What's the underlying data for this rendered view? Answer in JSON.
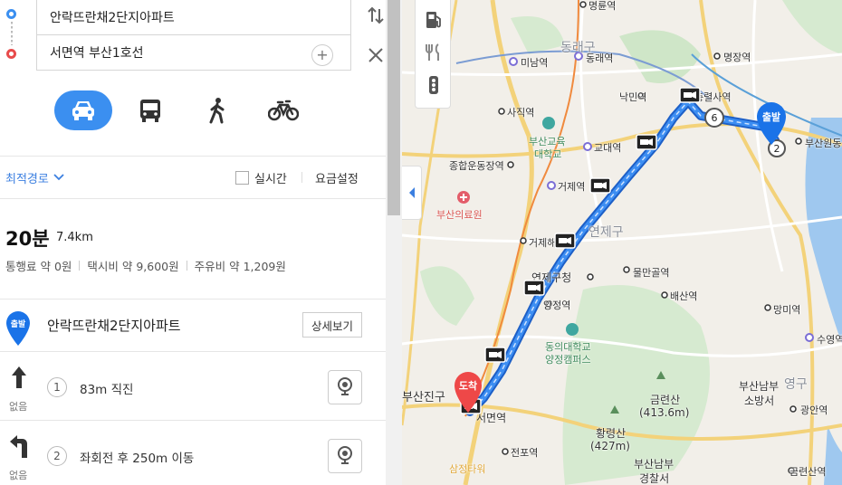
{
  "route": {
    "origin": "안락뜨란채2단지아파트",
    "destination": "서면역 부산1호선",
    "add_waypoint": "+"
  },
  "modes": [
    "car-icon",
    "bus-icon",
    "walk-icon",
    "bike-icon"
  ],
  "options": {
    "route_option": "최적경로",
    "realtime": "실시간",
    "fare_setting": "요금설정"
  },
  "summary": {
    "duration": "20분",
    "distance": "7.4km",
    "toll": "통행료 약 0원",
    "taxi": "택시비 약 9,600원",
    "fuel": "주유비 약 1,209원"
  },
  "steps": {
    "start_marker": "출발",
    "start_name": "안락뜨란채2단지아파트",
    "detail_button": "상세보기",
    "items": [
      {
        "num": "1",
        "text": "83m 직진",
        "none": "없음"
      },
      {
        "num": "2",
        "text": "좌회전 후 250m 이동",
        "none": "없음"
      }
    ]
  },
  "map": {
    "labels": {
      "myeongnyun": "명륜역",
      "dongnae_gu": "동래구",
      "minamyeok": "미남역",
      "dongnaeyeok": "동래역",
      "myeongjang": "명장역",
      "naksin": "낙민역",
      "chungnyeol": "충렬사역",
      "sajik": "사직역",
      "busan_edu": "부산교육",
      "busan_edu2": "대학교",
      "gyodae": "교대역",
      "busanwondong": "부산원동",
      "sports": "종합운동장역",
      "geoje": "거제역",
      "busan_hospital": "부산의료원",
      "geoje_hae": "거제해",
      "yeonje_gu": "연제구",
      "yeonje_office": "연제구청",
      "mulmangol": "물만골역",
      "baesan": "배산역",
      "mangmi": "망미역",
      "suyeong": "수영역",
      "yangjeong": "양정역",
      "dongeui": "동의대학교",
      "dongeui2": "양정캠퍼스",
      "busanjin": "부산진구",
      "seomyeon": "서면역",
      "geumryeonsan": "금련산",
      "geumryeonsan_h": "(413.6m)",
      "hwangnyeongsan": "황령산",
      "hwangnyeongsan_h": "(427m)",
      "jeonpo": "전포역",
      "samjeong": "삼정타워",
      "busan_nambu": "부산남부",
      "busan_nambu2": "소방서",
      "nambu_police": "부산남부",
      "nambu_police2": "경찰서",
      "gwangan": "광안역",
      "geumryeonsan_st": "금련산역",
      "suyeong_gu": "영구"
    },
    "start_pin": "출발",
    "end_pin": "도착",
    "badge_6": "6",
    "badge_2": "2",
    "colors": {
      "route": "#2f7de1",
      "start": "#1a73e8",
      "end": "#ee4848",
      "panel_accent": "#3b8ff0"
    }
  }
}
